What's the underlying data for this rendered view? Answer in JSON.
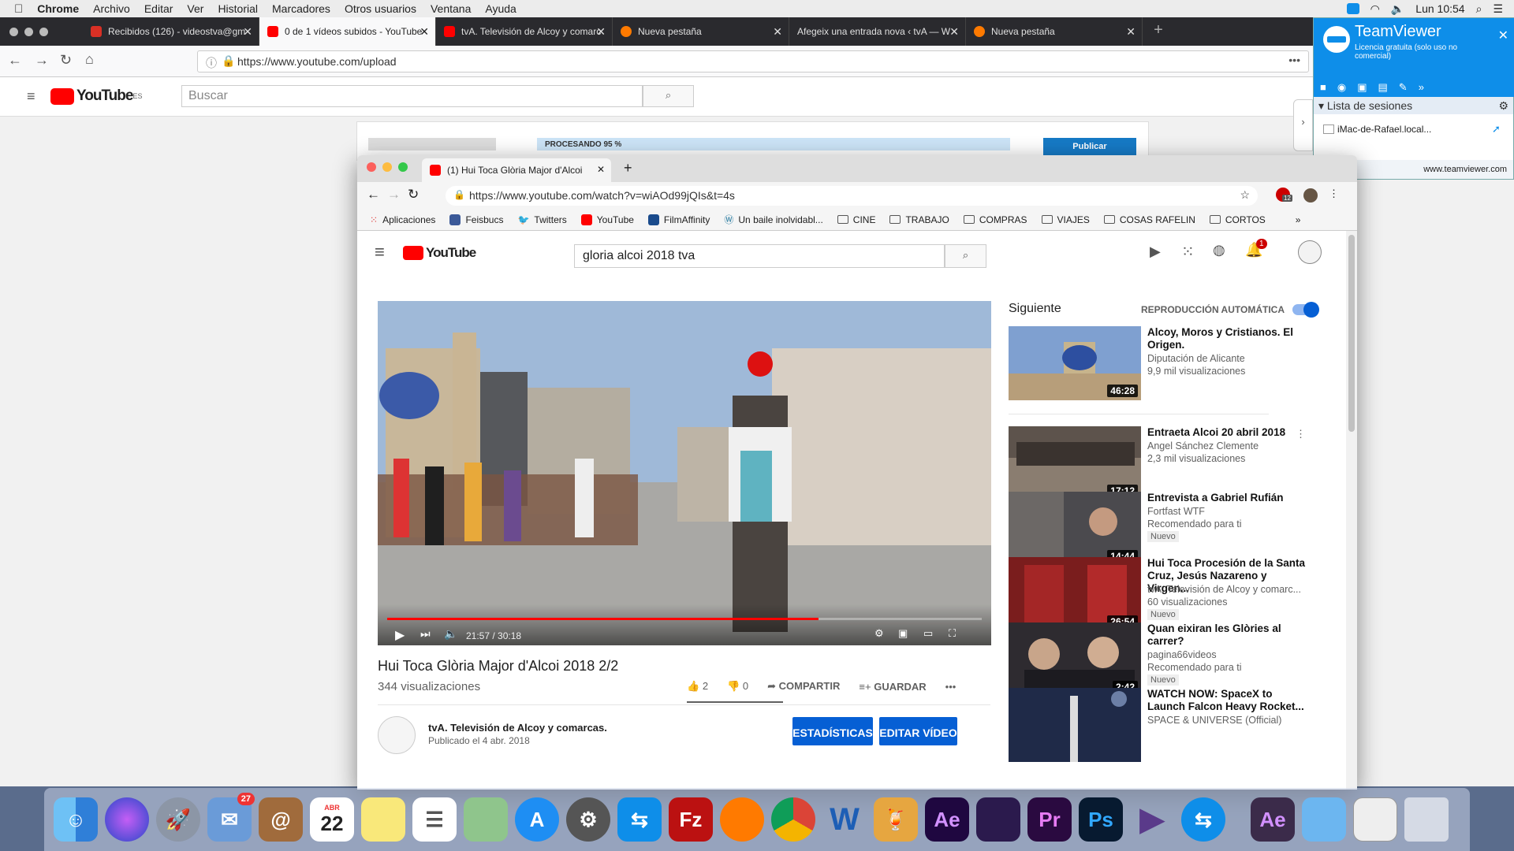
{
  "menubar": {
    "app": "Chrome",
    "items": [
      "Archivo",
      "Editar",
      "Ver",
      "Historial",
      "Marcadores",
      "Otros usuarios",
      "Ventana",
      "Ayuda"
    ],
    "clock": "Lun 10:54"
  },
  "firefox": {
    "tabs": [
      {
        "label": "Recibidos (126) - videostva@gm",
        "color": "#d93025"
      },
      {
        "label": "0 de 1 vídeos subidos - YouTube",
        "color": "#ff0000"
      },
      {
        "label": "tvA. Televisión de Alcoy y comarc",
        "color": "#ff0000"
      },
      {
        "label": "Nueva pestaña",
        "color": "#ff7a00"
      },
      {
        "label": "Afegeix una entrada nova ‹ tvA — W",
        "color": "#777"
      },
      {
        "label": "Nueva pestaña",
        "color": "#ff7a00"
      }
    ],
    "url": "https://www.youtube.com/upload",
    "search_placeholder": "Buscar",
    "processing": "PROCESANDO 95 %",
    "publish": "Publicar"
  },
  "teamviewer": {
    "title": "TeamViewer",
    "subtitle": "Licencia gratuita (solo uso no comercial)",
    "sessions_label": "Lista de sesiones",
    "session": "iMac-de-Rafael.local...",
    "link": "www.teamviewer.com"
  },
  "chrome": {
    "tab_title": "(1) Hui Toca Glòria Major d'Alcoi",
    "url": "https://www.youtube.com/watch?v=wiAOd99jQIs&t=4s",
    "bookmarks": [
      "Aplicaciones",
      "Feisbucs",
      "Twitters",
      "YouTube",
      "FilmAffinity",
      "Un baile inolvidabl...",
      "CINE",
      "TRABAJO",
      "COMPRAS",
      "VIAJES",
      "COSAS RAFELIN",
      "CORTOS"
    ],
    "search_value": "gloria alcoi 2018 tva",
    "notifications": "1",
    "ext_badge": "12"
  },
  "video": {
    "time": "21:57 / 30:18",
    "progress": 0.725,
    "title": "Hui Toca Glòria Major d'Alcoi 2018 2/2",
    "views": "344 visualizaciones",
    "likes": "2",
    "dislikes": "0",
    "share": "COMPARTIR",
    "save": "GUARDAR",
    "channel": "tvA. Televisión de Alcoy y comarcas.",
    "published": "Publicado el 4 abr. 2018",
    "stats_btn": "ESTADÍSTICAS",
    "edit_btn": "EDITAR VÍDEO"
  },
  "sidebar": {
    "next": "Siguiente",
    "autoplay": "REPRODUCCIÓN AUTOMÁTICA",
    "items": [
      {
        "title": "Alcoy, Moros y Cristianos. El Origen.",
        "channel": "Diputación de Alicante",
        "meta": "9,9 mil visualizaciones",
        "badge": "",
        "duration": "46:28"
      },
      {
        "title": "Entraeta Alcoi 20 abril 2018",
        "channel": "Angel Sánchez Clemente",
        "meta": "2,3 mil visualizaciones",
        "badge": "",
        "duration": "17:12"
      },
      {
        "title": "Entrevista a Gabriel Rufián",
        "channel": "Fortfast WTF",
        "meta": "Recomendado para ti",
        "badge": "Nuevo",
        "duration": "14:44"
      },
      {
        "title": "Hui Toca Procesión de la Santa Cruz, Jesús Nazareno y Virgen...",
        "channel": "tvA. Televisión de Alcoy y comarc...",
        "meta": "60 visualizaciones",
        "badge": "Nuevo",
        "duration": "26:54"
      },
      {
        "title": "Quan eixiran les Glòries al carrer?",
        "channel": "pagina66videos",
        "meta": "Recomendado para ti",
        "badge": "Nuevo",
        "duration": "2:42"
      },
      {
        "title": "WATCH NOW: SpaceX to Launch Falcon Heavy Rocket...",
        "channel": "SPACE & UNIVERSE (Official)",
        "meta": "",
        "badge": "",
        "duration": ""
      }
    ]
  },
  "dock": {
    "mail_badge": "27",
    "calendar_month": "ABR",
    "calendar_day": "22"
  }
}
